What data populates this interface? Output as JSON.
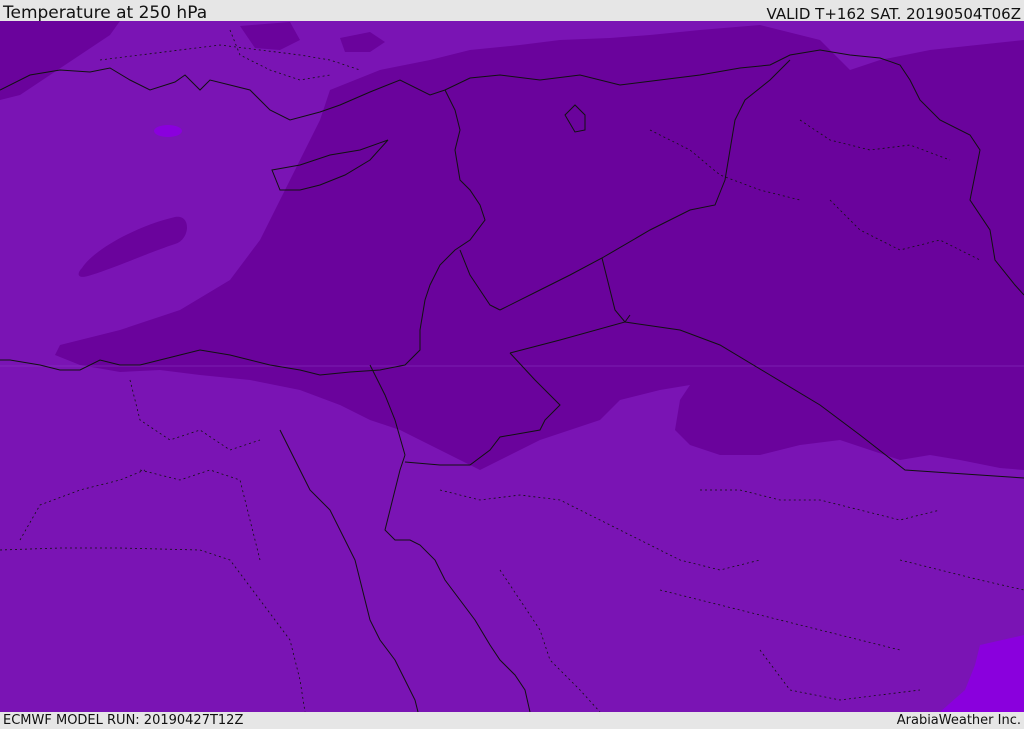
{
  "header": {
    "title": "Temperature at 250 hPa",
    "valid": "VALID T+162 SAT. 20190504T06Z"
  },
  "footer": {
    "model_run": "ECMWF MODEL RUN: 20190427T12Z",
    "credit": "ArabiaWeather Inc."
  },
  "map": {
    "colors": {
      "band_warm": "#7a14b4",
      "band_cold": "#6a039c",
      "band_highlight": "#8a00dd",
      "coastline": "#111111",
      "border": "#111111"
    },
    "fields": [
      {
        "name": "background",
        "color_key": "band_warm"
      },
      {
        "name": "cold-core",
        "color_key": "band_cold"
      },
      {
        "name": "warm-patch",
        "color_key": "band_highlight"
      }
    ]
  }
}
